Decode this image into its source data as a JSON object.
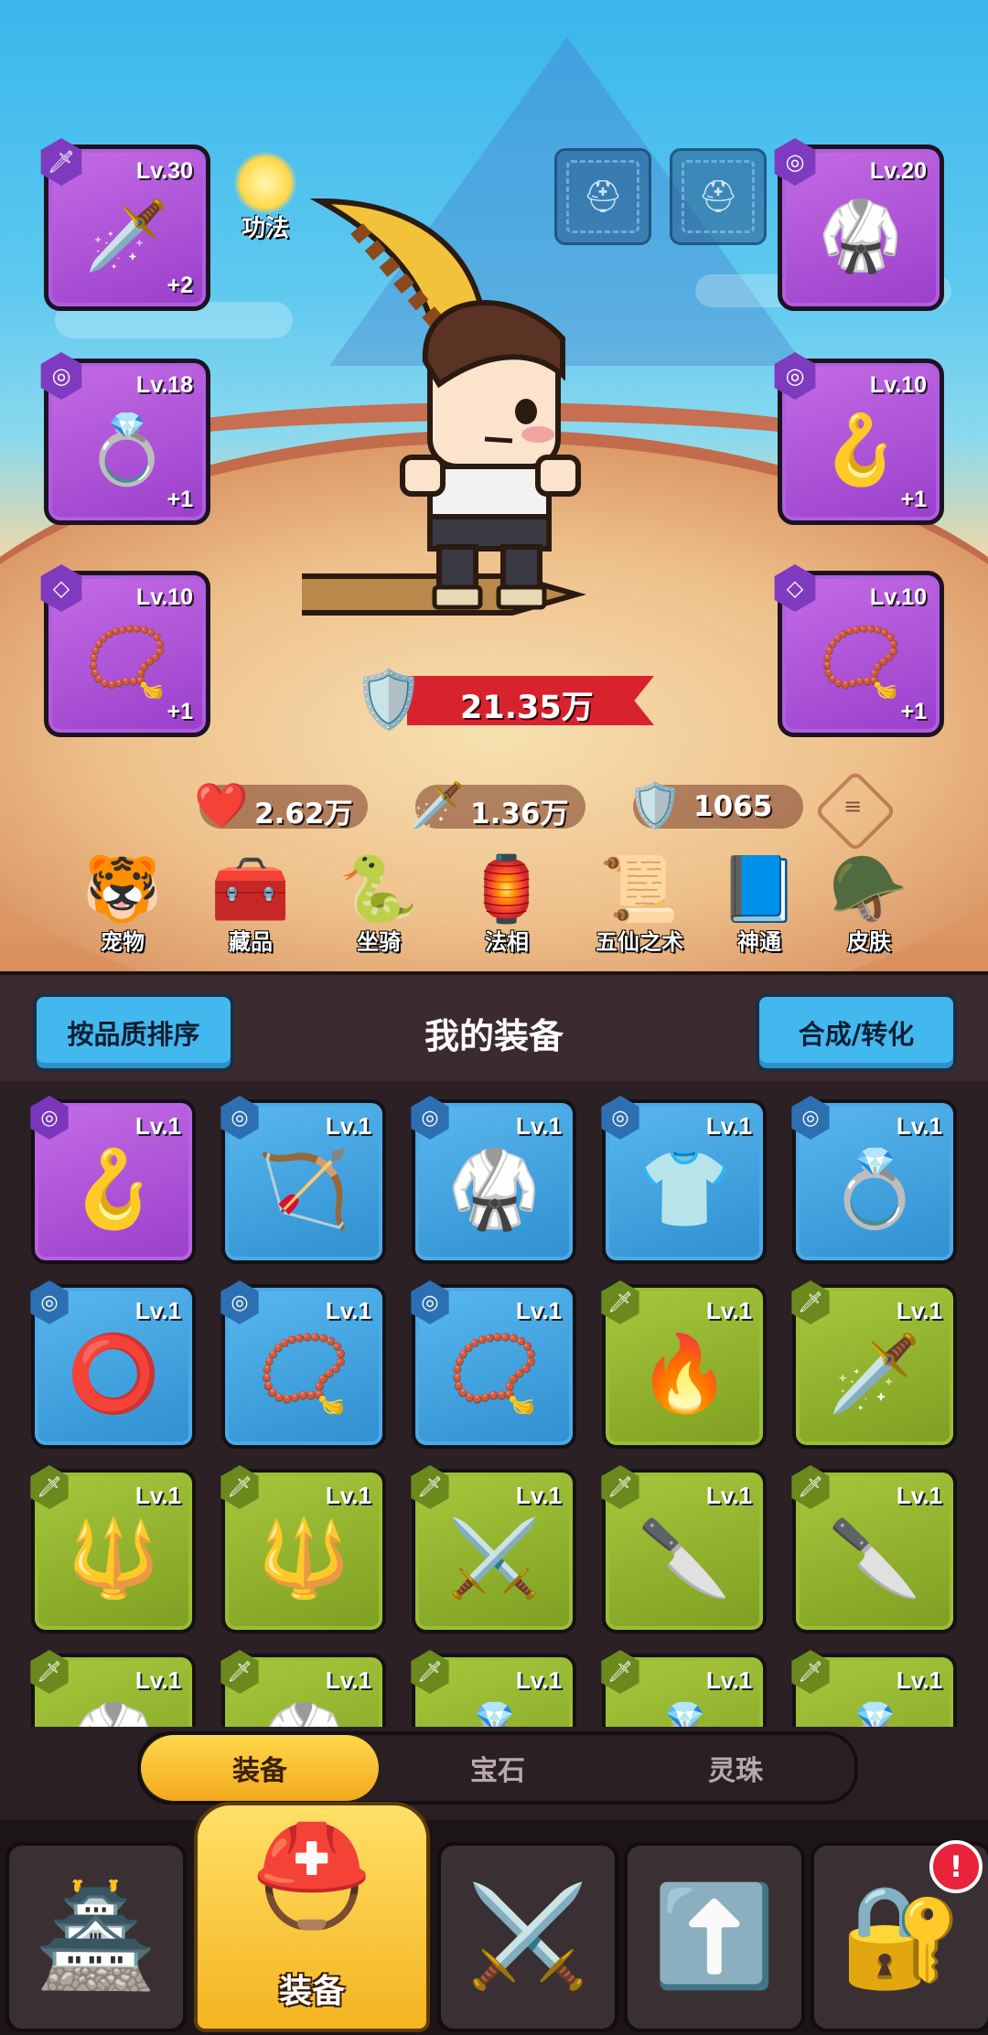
{
  "character": {
    "slots": [
      {
        "id": "weapon",
        "level": "Lv.30",
        "plus": "+2",
        "badge": "🗡",
        "art": "🗡️"
      },
      {
        "id": "ring-left",
        "level": "Lv.18",
        "plus": "+1",
        "badge": "◎",
        "art": "💍"
      },
      {
        "id": "necklace-left",
        "level": "Lv.10",
        "plus": "+1",
        "badge": "◇",
        "art": "📿"
      },
      {
        "id": "armor",
        "level": "Lv.20",
        "plus": "",
        "badge": "◎",
        "art": "🥋"
      },
      {
        "id": "bracelet",
        "level": "Lv.10",
        "plus": "+1",
        "badge": "◎",
        "art": "🪝"
      },
      {
        "id": "necklace-right",
        "level": "Lv.10",
        "plus": "+1",
        "badge": "◇",
        "art": "📿"
      }
    ],
    "gongfa_label": "功法",
    "power": "21.35万",
    "stats": {
      "hp": "2.62万",
      "attack": "1.36万",
      "defense": "1065"
    },
    "menu": [
      {
        "label": "宠物",
        "icon": "🐯"
      },
      {
        "label": "藏品",
        "icon": "🧰"
      },
      {
        "label": "坐骑",
        "icon": "🐍"
      },
      {
        "label": "法相",
        "icon": "🏮"
      },
      {
        "label": "五仙之术",
        "icon": "📜"
      },
      {
        "label": "神通",
        "icon": "📘"
      },
      {
        "label": "皮肤",
        "icon": "🪖"
      }
    ]
  },
  "inventory": {
    "sort_button": "按品质排序",
    "title": "我的装备",
    "craft_button": "合成/转化",
    "items": [
      {
        "level": "Lv.1",
        "rarity": "purple",
        "art": "🪝"
      },
      {
        "level": "Lv.1",
        "rarity": "blue",
        "art": "🏹"
      },
      {
        "level": "Lv.1",
        "rarity": "blue",
        "art": "🥋"
      },
      {
        "level": "Lv.1",
        "rarity": "blue",
        "art": "👕"
      },
      {
        "level": "Lv.1",
        "rarity": "blue",
        "art": "💍"
      },
      {
        "level": "Lv.1",
        "rarity": "blue",
        "art": "⭕"
      },
      {
        "level": "Lv.1",
        "rarity": "blue",
        "art": "📿"
      },
      {
        "level": "Lv.1",
        "rarity": "blue",
        "art": "📿"
      },
      {
        "level": "Lv.1",
        "rarity": "green",
        "art": "🔥"
      },
      {
        "level": "Lv.1",
        "rarity": "green",
        "art": "🗡️"
      },
      {
        "level": "Lv.1",
        "rarity": "green",
        "art": "🔱"
      },
      {
        "level": "Lv.1",
        "rarity": "green",
        "art": "🔱"
      },
      {
        "level": "Lv.1",
        "rarity": "green",
        "art": "⚔️"
      },
      {
        "level": "Lv.1",
        "rarity": "green",
        "art": "🔪"
      },
      {
        "level": "Lv.1",
        "rarity": "green",
        "art": "🔪"
      },
      {
        "level": "Lv.1",
        "rarity": "green",
        "art": "🥋"
      },
      {
        "level": "Lv.1",
        "rarity": "green",
        "art": "🥋"
      },
      {
        "level": "Lv.1",
        "rarity": "green",
        "art": "💍"
      },
      {
        "level": "Lv.1",
        "rarity": "green",
        "art": "💍"
      },
      {
        "level": "Lv.1",
        "rarity": "green",
        "art": "💍"
      }
    ]
  },
  "tabs": [
    {
      "label": "装备",
      "active": true
    },
    {
      "label": "宝石",
      "active": false
    },
    {
      "label": "灵珠",
      "active": false
    }
  ],
  "bottom_nav": [
    {
      "name": "shop",
      "icon": "🏯",
      "label": ""
    },
    {
      "name": "equipment",
      "icon": "⛑️",
      "label": "装备",
      "active": true
    },
    {
      "name": "battle",
      "icon": "⚔️",
      "label": ""
    },
    {
      "name": "upgrade",
      "icon": "⬆️",
      "label": ""
    },
    {
      "name": "chest",
      "icon": "🔐",
      "label": "",
      "alert": "!"
    }
  ],
  "colors": {
    "accent": "#f3a91d",
    "purple": "#9a3fca",
    "blue": "#2f8fd0",
    "green": "#7e9e22",
    "power_red": "#d8232f"
  }
}
